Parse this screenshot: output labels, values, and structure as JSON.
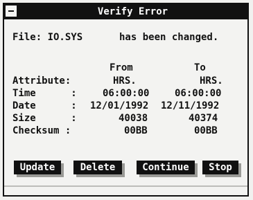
{
  "window": {
    "title": "Verify Error"
  },
  "message": {
    "file_label": "File: IO.SYS",
    "status": "has been changed."
  },
  "table": {
    "headers": {
      "from": "From",
      "to": "To"
    },
    "rows": [
      {
        "label": "Attribute:",
        "from": "HRS.",
        "to": "HRS."
      },
      {
        "label": "Time      :",
        "from": "06:00:00",
        "to": "06:00:00"
      },
      {
        "label": "Date      :",
        "from": "12/01/1992",
        "to": "12/11/1992"
      },
      {
        "label": "Size      :",
        "from": "40038",
        "to": "40374"
      },
      {
        "label": "Checksum :",
        "from": "00BB",
        "to": "00BB"
      }
    ]
  },
  "buttons": {
    "update": "Update",
    "delete": "Delete",
    "continue": "Continue",
    "stop": "Stop"
  }
}
